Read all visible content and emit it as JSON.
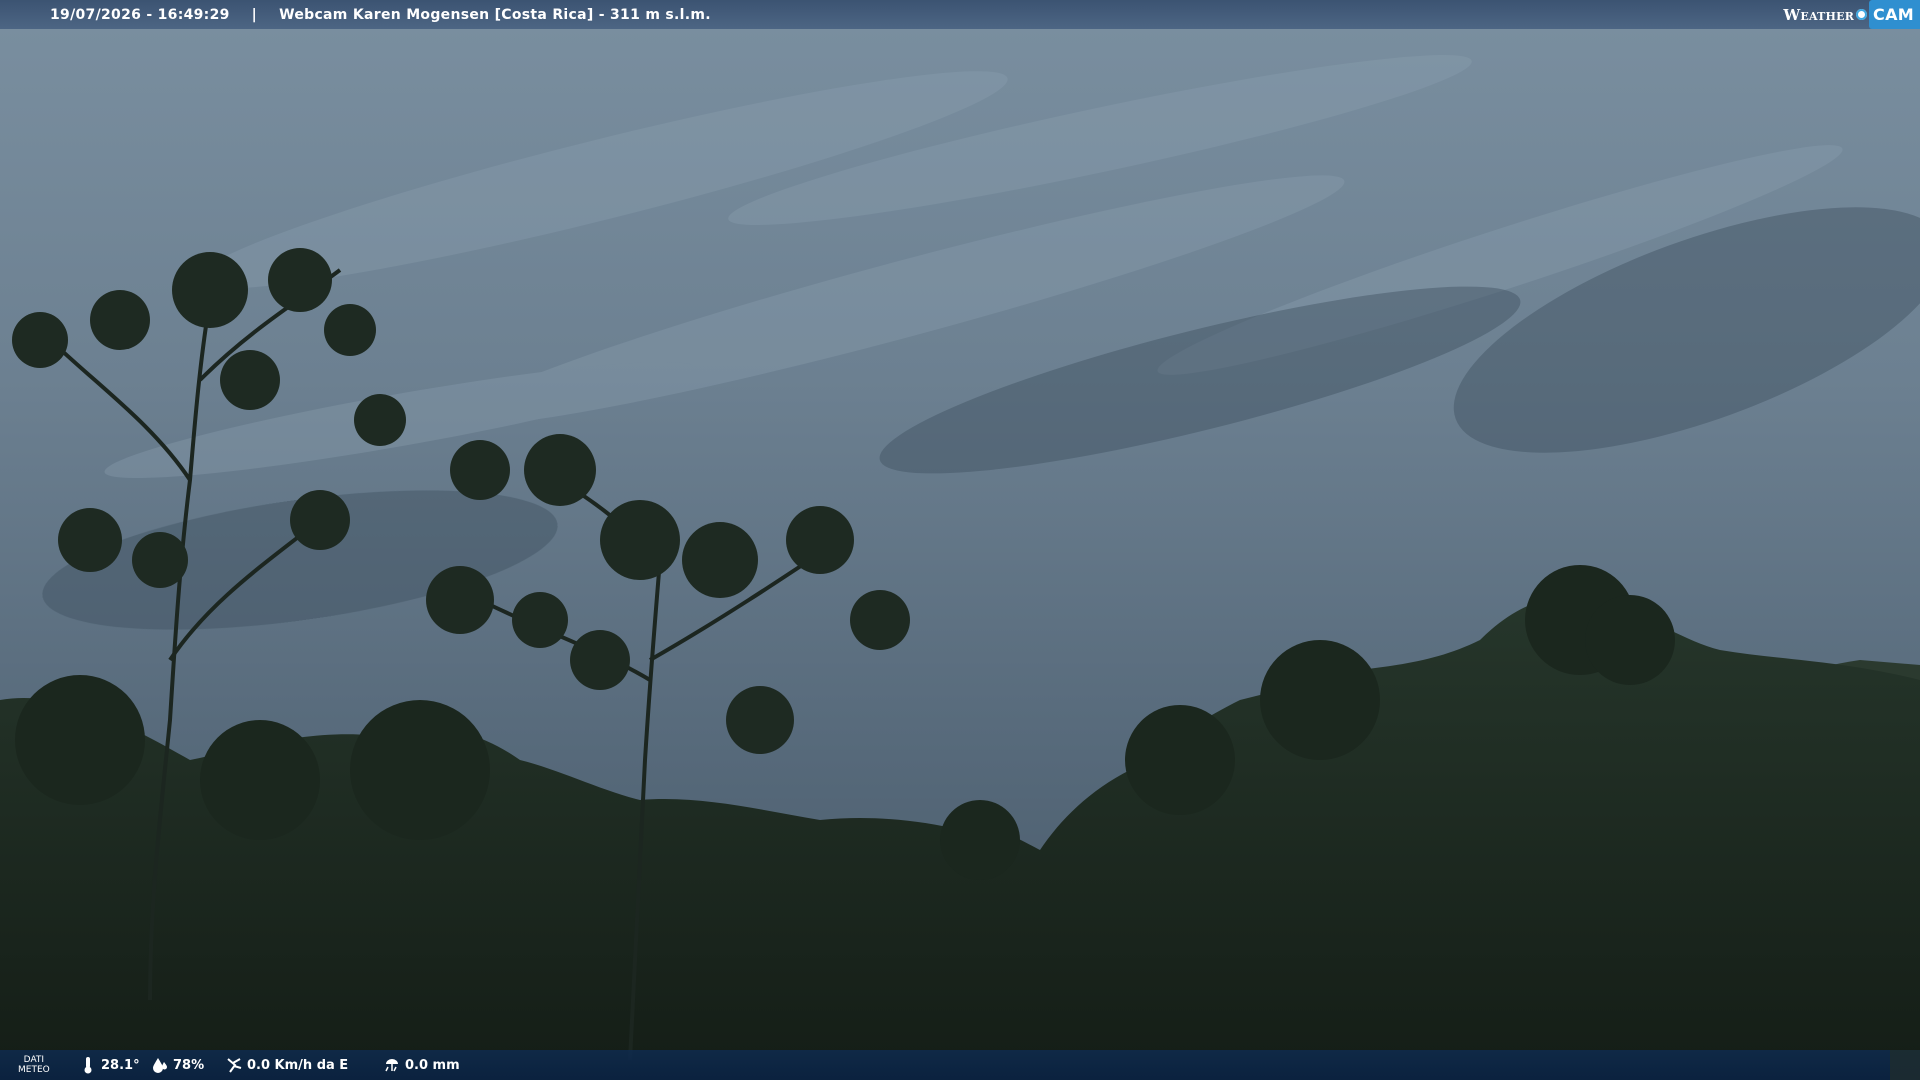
{
  "header": {
    "datetime": "19/07/2026 - 16:49:29",
    "separator": "|",
    "title": "Webcam Karen Mogensen [Costa Rica] - 311 m s.l.m.",
    "logo_text_1": "Weather",
    "logo_text_2": "CAM"
  },
  "weather_bar": {
    "label_line1": "DATI",
    "label_line2": "METEO",
    "temperature": "28.1°",
    "humidity": "78%",
    "wind": "0.0 Km/h da E",
    "rain": "0.0 mm"
  },
  "icons": {
    "temperature": "thermometer-icon",
    "humidity": "humidity-drop-icon",
    "wind": "wind-icon",
    "rain": "rain-icon"
  },
  "colors": {
    "sky": "#5e7282",
    "foliage": "#1d2b20",
    "bar_top": "#3a5578",
    "bar_bottom": "#0e2c52",
    "logo_accent": "#2f8fd0"
  }
}
